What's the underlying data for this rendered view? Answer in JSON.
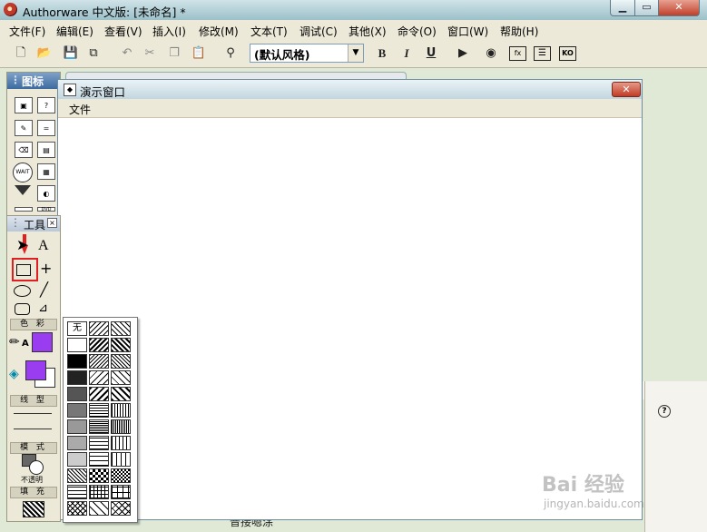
{
  "window": {
    "title": "Authorware 中文版: [未命名] *"
  },
  "menubar": [
    "文件(F)",
    "编辑(E)",
    "查看(V)",
    "插入(I)",
    "修改(M)",
    "文本(T)",
    "调试(C)",
    "其他(X)",
    "命令(O)",
    "窗口(W)",
    "帮助(H)"
  ],
  "toolbar": {
    "style_value": "(默认风格)",
    "bold": "B",
    "italic": "I",
    "underline": "U"
  },
  "icon_palette": {
    "title": "图标",
    "items": [
      "?",
      "=",
      "WAIT",
      "DVD"
    ]
  },
  "presentation_window": {
    "title": "演示窗口",
    "menu_file": "文件"
  },
  "tools_palette": {
    "title": "工具",
    "text_tool": "A",
    "color_label": "色 彩",
    "line_label": "线 型",
    "mode_label": "模 式",
    "mode_value": "不透明",
    "fill_label": "填 充",
    "accent_color": "#9a3cf0",
    "highlight_color": "#e02020"
  },
  "pattern_popup": {
    "none_label": "无"
  },
  "bottom_text": "普接嗯涂",
  "help_icon": "?",
  "watermark": {
    "text": "Bai 经验",
    "sub": "jingyan.baidu.com"
  }
}
